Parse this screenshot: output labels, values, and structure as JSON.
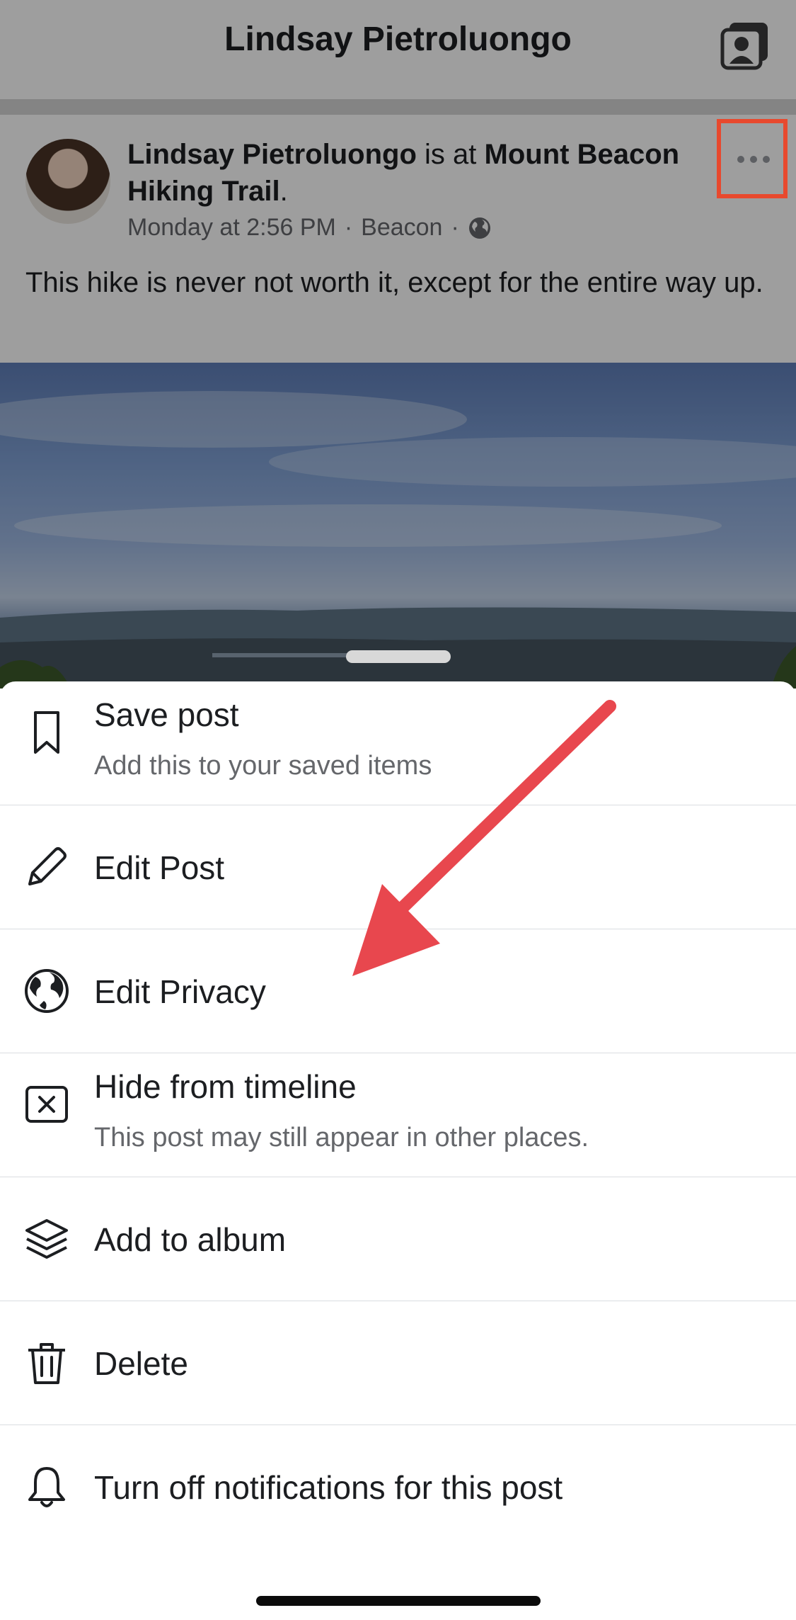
{
  "header": {
    "title": "Lindsay Pietroluongo",
    "profile_icon": "profile-switch-icon"
  },
  "post": {
    "author": "Lindsay Pietroluongo",
    "connector": "is at",
    "place": "Mount Beacon Hiking Trail",
    "period": ".",
    "timestamp": "Monday at 2:56 PM",
    "separator_1": "·",
    "location": "Beacon",
    "separator_2": "·",
    "audience_icon": "globe-icon",
    "text": "This hike is never not worth it, except for the entire way up.",
    "more_icon": "more-options-icon"
  },
  "sheet": {
    "items": [
      {
        "title": "Save post",
        "subtitle": "Add this to your saved items",
        "icon": "bookmark-icon"
      },
      {
        "title": "Edit Post",
        "icon": "pencil-icon"
      },
      {
        "title": "Edit Privacy",
        "icon": "globe-icon"
      },
      {
        "title": "Hide from timeline",
        "subtitle": "This post may still appear in other places.",
        "icon": "hide-x-icon"
      },
      {
        "title": "Add to album",
        "icon": "album-layers-icon"
      },
      {
        "title": "Delete",
        "icon": "trash-icon"
      },
      {
        "title": "Turn off notifications for this post",
        "icon": "bell-icon"
      }
    ]
  },
  "annotation": {
    "arrow_color": "#e8474e",
    "highlight_color": "#e8492e"
  }
}
